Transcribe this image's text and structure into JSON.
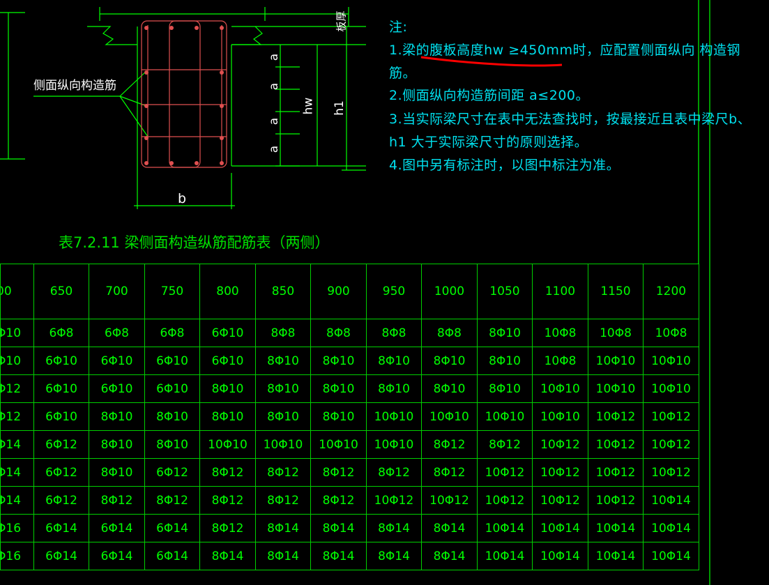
{
  "notes": {
    "heading": "注:",
    "n1a": "1.梁的腹板高度hw ≥450mm时，应配置侧面纵向  构造钢",
    "n1b": "筋。",
    "n2": "2.侧面纵向构造筋间距 a≤200。",
    "n3a": "3.当实际梁尺寸在表中无法查找时，按最接近且表中梁尺b、",
    "n3b": "h1 大于实际梁尺寸的原则选择。",
    "n4": "4.图中另有标注时，以图中标注为准。",
    "underline_color": "#ff0000"
  },
  "drawing": {
    "side_label": "侧面纵向构造筋",
    "dim_a": "a",
    "dim_hw": "hw",
    "dim_h1": "h1",
    "dim_b": "b",
    "slab_thickness": "板厚",
    "rebar_color": "#e05050",
    "line_color": "#00ff00"
  },
  "table": {
    "title": "表7.2.11  梁侧面构造纵筋配筋表（两侧）",
    "headers": [
      "00",
      "650",
      "700",
      "750",
      "800",
      "850",
      "900",
      "950",
      "1000",
      "1050",
      "1100",
      "1150",
      "1200"
    ],
    "rows": [
      [
        "Φ10",
        "6Φ8",
        "6Φ8",
        "6Φ8",
        "6Φ10",
        "8Φ8",
        "8Φ8",
        "8Φ8",
        "8Φ8",
        "8Φ10",
        "10Φ8",
        "10Φ8",
        "10Φ8"
      ],
      [
        "Φ10",
        "6Φ10",
        "6Φ10",
        "6Φ10",
        "6Φ10",
        "8Φ10",
        "8Φ10",
        "8Φ10",
        "8Φ10",
        "8Φ10",
        "10Φ8",
        "10Φ10",
        "10Φ10"
      ],
      [
        "Φ12",
        "6Φ10",
        "6Φ10",
        "6Φ10",
        "8Φ10",
        "8Φ10",
        "8Φ10",
        "8Φ10",
        "8Φ10",
        "8Φ10",
        "10Φ10",
        "10Φ10",
        "10Φ10"
      ],
      [
        "Φ12",
        "6Φ10",
        "8Φ10",
        "8Φ10",
        "8Φ10",
        "8Φ10",
        "8Φ10",
        "10Φ10",
        "10Φ10",
        "10Φ10",
        "10Φ10",
        "10Φ12",
        "10Φ12"
      ],
      [
        "Φ14",
        "6Φ12",
        "8Φ10",
        "8Φ10",
        "10Φ10",
        "10Φ10",
        "10Φ10",
        "10Φ10",
        "8Φ12",
        "8Φ12",
        "10Φ12",
        "10Φ12",
        "10Φ12"
      ],
      [
        "Φ14",
        "6Φ12",
        "8Φ10",
        "6Φ12",
        "8Φ12",
        "8Φ12",
        "8Φ12",
        "8Φ12",
        "8Φ12",
        "10Φ12",
        "10Φ12",
        "10Φ12",
        "10Φ12"
      ],
      [
        "Φ14",
        "6Φ12",
        "8Φ12",
        "8Φ12",
        "8Φ12",
        "8Φ12",
        "8Φ12",
        "10Φ12",
        "10Φ12",
        "10Φ12",
        "10Φ12",
        "10Φ12",
        "10Φ14"
      ],
      [
        "Φ16",
        "6Φ14",
        "6Φ14",
        "6Φ14",
        "8Φ12",
        "8Φ14",
        "8Φ14",
        "8Φ14",
        "8Φ14",
        "10Φ14",
        "10Φ14",
        "10Φ14",
        "10Φ14"
      ],
      [
        "Φ16",
        "6Φ14",
        "6Φ14",
        "6Φ14",
        "8Φ14",
        "8Φ14",
        "8Φ14",
        "8Φ14",
        "8Φ14",
        "10Φ14",
        "10Φ14",
        "10Φ14",
        "10Φ14"
      ]
    ]
  }
}
